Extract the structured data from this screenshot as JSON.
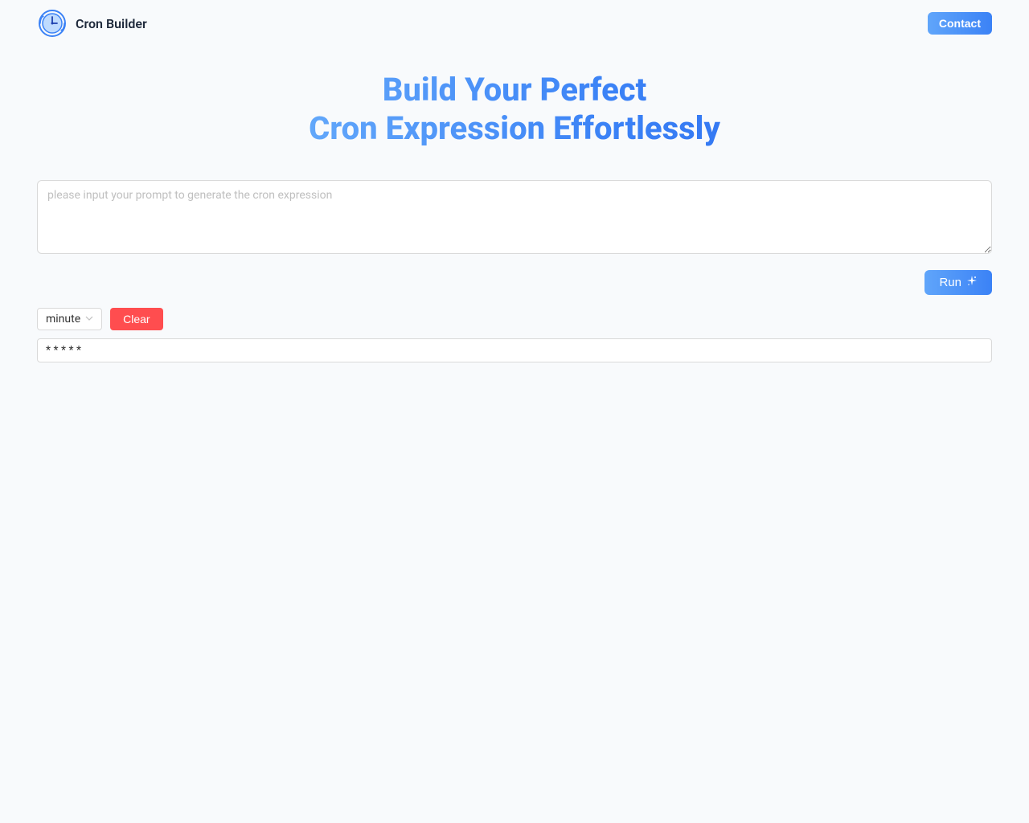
{
  "header": {
    "logo_text": "Cron Builder",
    "contact_label": "Contact"
  },
  "hero": {
    "title_line1": "Build Your Perfect",
    "title_line2": "Cron Expression Effortlessly"
  },
  "prompt": {
    "placeholder": "please input your prompt to generate the cron expression",
    "value": ""
  },
  "run": {
    "label": "Run"
  },
  "controls": {
    "period_selected": "minute",
    "clear_label": "Clear"
  },
  "output": {
    "cron_expression": "* * * * *"
  }
}
